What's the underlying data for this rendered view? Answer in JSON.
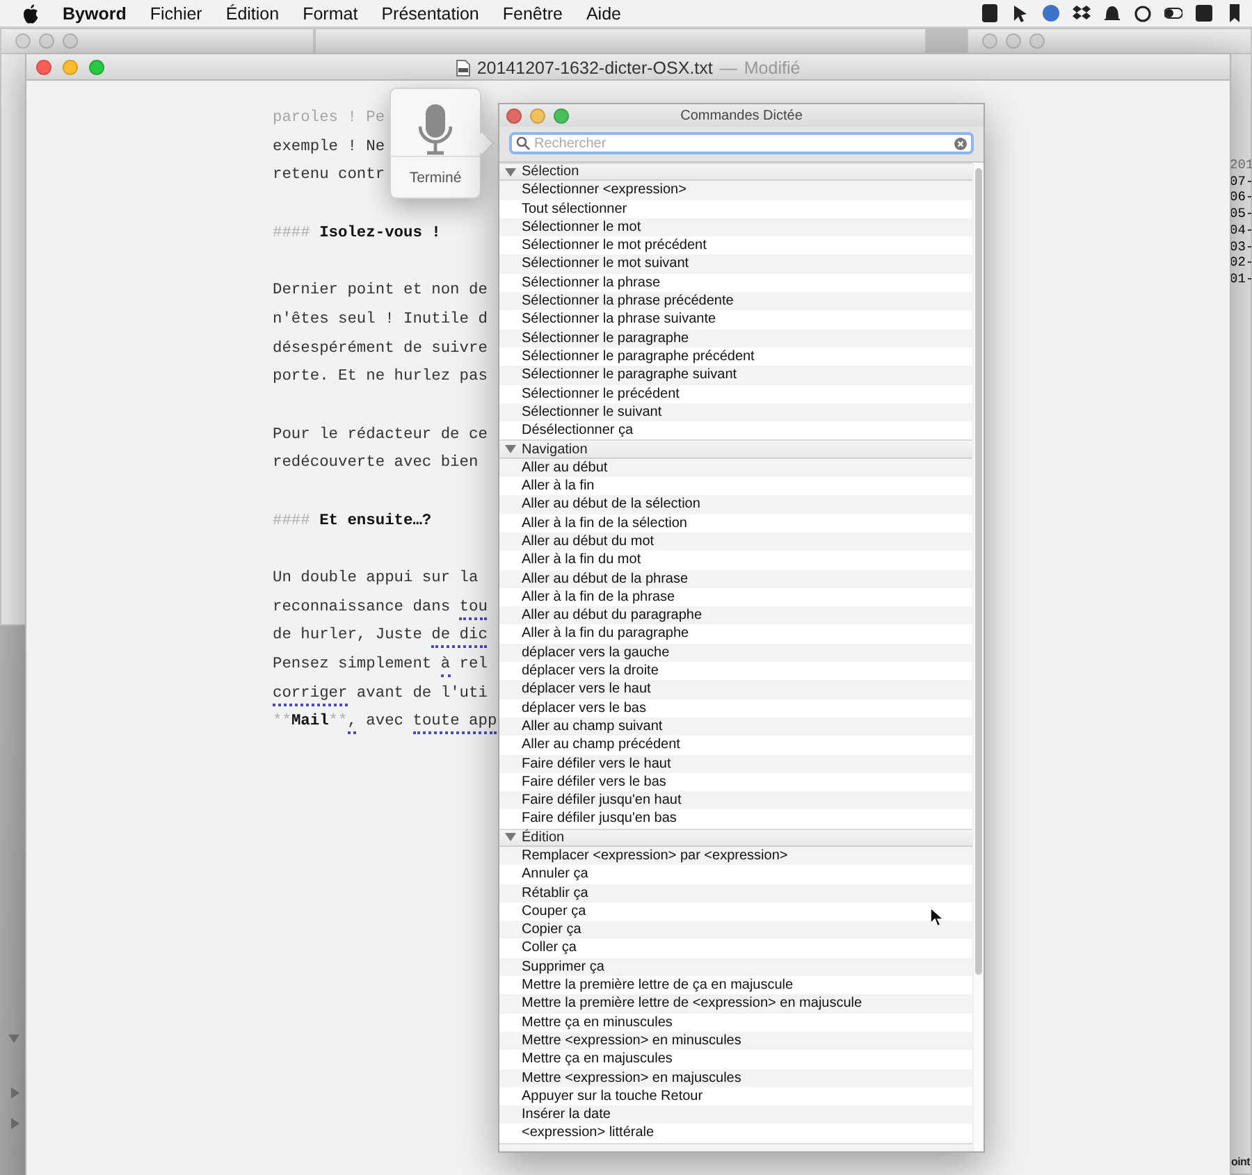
{
  "menubar": {
    "app": "Byword",
    "menus": [
      "Fichier",
      "Édition",
      "Format",
      "Présentation",
      "Fenêtre",
      "Aide"
    ]
  },
  "editor": {
    "title": "20141207-1632-dicter-OSX.txt",
    "separator": "—",
    "status": "Modifié",
    "lines": [
      {
        "kind": "text",
        "faded": true,
        "parts": [
          {
            "text": "paroles ! Pe",
            "kind": "plain"
          }
        ]
      },
      {
        "kind": "text",
        "faded": false,
        "parts": [
          {
            "text": "exemple ! Ne",
            "kind": "plain"
          }
        ]
      },
      {
        "kind": "text",
        "faded": false,
        "parts": [
          {
            "text": "retenu contr",
            "kind": "plain"
          }
        ]
      },
      {
        "kind": "blank"
      },
      {
        "kind": "text",
        "faded": false,
        "parts": [
          {
            "text": "####",
            "kind": "marker"
          },
          {
            "text": " Isolez-vous !",
            "kind": "bold"
          }
        ]
      },
      {
        "kind": "blank"
      },
      {
        "kind": "text",
        "faded": false,
        "parts": [
          {
            "text": "Dernier point et non de",
            "kind": "plain"
          }
        ]
      },
      {
        "kind": "text",
        "faded": false,
        "parts": [
          {
            "text": "n'êtes seul ! Inutile d",
            "kind": "plain"
          }
        ]
      },
      {
        "kind": "text",
        "faded": false,
        "parts": [
          {
            "text": "désespérément de suivre",
            "kind": "plain"
          }
        ]
      },
      {
        "kind": "text",
        "faded": false,
        "parts": [
          {
            "text": "porte. Et ne hurlez pas",
            "kind": "plain"
          }
        ]
      },
      {
        "kind": "blank"
      },
      {
        "kind": "text",
        "faded": false,
        "parts": [
          {
            "text": "Pour le rédacteur de ce",
            "kind": "plain"
          }
        ]
      },
      {
        "kind": "text",
        "faded": false,
        "parts": [
          {
            "text": "redécouverte avec bien",
            "kind": "plain"
          }
        ]
      },
      {
        "kind": "blank"
      },
      {
        "kind": "text",
        "faded": false,
        "parts": [
          {
            "text": "####",
            "kind": "marker"
          },
          {
            "text": " Et ensuite…?",
            "kind": "bold"
          }
        ]
      },
      {
        "kind": "blank"
      },
      {
        "kind": "text",
        "faded": false,
        "parts": [
          {
            "text": "Un double appui sur la",
            "kind": "plain"
          }
        ]
      },
      {
        "kind": "text",
        "faded": false,
        "parts": [
          {
            "text": "reconnaissance dans ",
            "kind": "plain"
          },
          {
            "text": "tou",
            "kind": "flagged"
          }
        ]
      },
      {
        "kind": "text",
        "faded": false,
        "parts": [
          {
            "text": "de hurler, Juste ",
            "kind": "plain"
          },
          {
            "text": "de dic",
            "kind": "flagged"
          }
        ]
      },
      {
        "kind": "text",
        "faded": false,
        "parts": [
          {
            "text": "Pensez simplement ",
            "kind": "plain"
          },
          {
            "text": "à",
            "kind": "flagged"
          },
          {
            "text": " rel",
            "kind": "plain"
          }
        ]
      },
      {
        "kind": "text",
        "faded": false,
        "parts": [
          {
            "text": "corriger",
            "kind": "flagged"
          },
          {
            "text": " avant de l'uti",
            "kind": "plain"
          }
        ]
      },
      {
        "kind": "text",
        "faded": false,
        "parts": [
          {
            "text": "**",
            "kind": "marker"
          },
          {
            "text": "Mail",
            "kind": "bold"
          },
          {
            "text": "**",
            "kind": "marker"
          },
          {
            "text": ",",
            "kind": "flagged"
          },
          {
            "text": " avec ",
            "kind": "plain"
          },
          {
            "text": "toute app",
            "kind": "flagged"
          }
        ]
      }
    ]
  },
  "dictation": {
    "button": "Terminé"
  },
  "commands": {
    "title": "Commandes Dictée",
    "search": {
      "placeholder": "Rechercher"
    },
    "sections": [
      {
        "label": "Sélection",
        "expanded": true,
        "items": [
          "Sélectionner <expression>",
          "Tout sélectionner",
          "Sélectionner le mot",
          "Sélectionner le mot précédent",
          "Sélectionner le mot suivant",
          "Sélectionner la phrase",
          "Sélectionner la phrase précédente",
          "Sélectionner la phrase suivante",
          "Sélectionner le paragraphe",
          "Sélectionner le paragraphe précédent",
          "Sélectionner le paragraphe suivant",
          "Sélectionner le précédent",
          "Sélectionner le suivant",
          "Désélectionner ça"
        ]
      },
      {
        "label": "Navigation",
        "expanded": true,
        "items": [
          "Aller au début",
          "Aller à la fin",
          "Aller au début de la sélection",
          "Aller à la fin de la sélection",
          "Aller au début du mot",
          "Aller à la fin du mot",
          "Aller au début de la phrase",
          "Aller à la fin de la phrase",
          "Aller au début du paragraphe",
          "Aller à la fin du paragraphe",
          "déplacer vers la gauche",
          "déplacer vers la droite",
          "déplacer vers le haut",
          "déplacer vers le bas",
          "Aller au champ suivant",
          "Aller au champ précédent",
          "Faire défiler vers le haut",
          "Faire défiler vers le bas",
          "Faire défiler jusqu'en haut",
          "Faire défiler jusqu'en bas"
        ]
      },
      {
        "label": "Édition",
        "expanded": true,
        "items": [
          "Remplacer <expression> par <expression>",
          "Annuler ça",
          "Rétablir ça",
          "Couper ça",
          "Copier ça",
          "Coller ça",
          "Supprimer ça",
          "Mettre la première lettre de ça en majuscule",
          "Mettre la première lettre de <expression> en majuscule",
          "Mettre ça en minuscules",
          "Mettre <expression> en minuscules",
          "Mettre ça en majuscules",
          "Mettre <expression> en majuscules",
          "Appuyer sur la touche Retour",
          "Insérer la date",
          "<expression> littérale"
        ]
      }
    ]
  },
  "background": {
    "dates_header": "201",
    "dates": [
      "07-",
      "06-",
      "05-",
      "04-",
      "03-",
      "02-",
      "01-"
    ],
    "fragments": [
      "oint"
    ]
  }
}
